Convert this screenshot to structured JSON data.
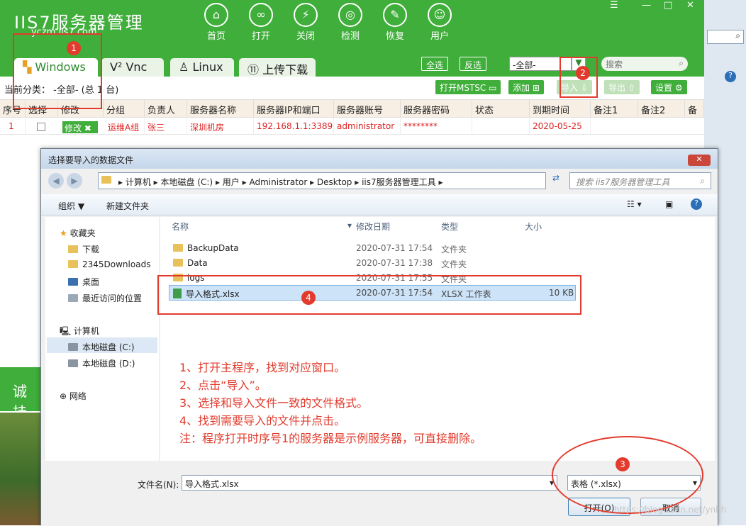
{
  "app": {
    "logo": "IIS7服务器管理",
    "logo_sub": "yczm.iis7.com",
    "toolbar": [
      {
        "label": "首页",
        "icon": "home-icon",
        "glyph": "⌂"
      },
      {
        "label": "打开",
        "icon": "link-icon",
        "glyph": "∞"
      },
      {
        "label": "关闭",
        "icon": "unlink-icon",
        "glyph": "⚡"
      },
      {
        "label": "检测",
        "icon": "detect-icon",
        "glyph": "◎"
      },
      {
        "label": "恢复",
        "icon": "wrench-icon",
        "glyph": "✎"
      },
      {
        "label": "用户",
        "icon": "user-icon",
        "glyph": "☺"
      }
    ],
    "tabs": [
      "Windows",
      "Vnc",
      "Linux",
      "上传下载"
    ],
    "select_all": "全选",
    "invert": "反选",
    "filter_value": "-全部-",
    "search_placeholder": "搜索",
    "category": "当前分类： -全部- (总 1 台)",
    "actions": [
      "打开MSTSC",
      "添加",
      "导入",
      "导出",
      "设置"
    ],
    "columns": [
      "序号",
      "选择",
      "修改",
      "分组",
      "负责人",
      "服务器名称",
      "服务器IP和端口",
      "服务器账号",
      "服务器密码",
      "状态",
      "到期时间",
      "备注1",
      "备注2",
      "备注"
    ],
    "row": {
      "index": "1",
      "edit": "修改",
      "group": "运维A组",
      "owner": "张三",
      "name": "深圳机房",
      "ip": "192.168.1.1:3389",
      "account": "administrator",
      "password": "********",
      "status": "",
      "expire": "2020-05-25"
    },
    "side_text": "诚 挂"
  },
  "dialog": {
    "title": "选择要导入的数据文件",
    "breadcrumb": [
      "计算机",
      "本地磁盘 (C:)",
      "用户",
      "Administrator",
      "Desktop",
      "iis7服务器管理工具"
    ],
    "search_placeholder": "搜索 iis7服务器管理工具",
    "organize": "组织 ▼",
    "new_folder": "新建文件夹",
    "nav": {
      "favorites": "收藏夹",
      "fav_items": [
        "下载",
        "2345Downloads",
        "桌面",
        "最近访问的位置"
      ],
      "computer": "计算机",
      "drives": [
        "本地磁盘 (C:)",
        "本地磁盘 (D:)"
      ],
      "network": "网络"
    },
    "col_headers": [
      "名称",
      "修改日期",
      "类型",
      "大小"
    ],
    "files": [
      {
        "name": "BackupData",
        "date": "2020-07-31 17:54",
        "type": "文件夹",
        "size": ""
      },
      {
        "name": "Data",
        "date": "2020-07-31 17:38",
        "type": "文件夹",
        "size": ""
      },
      {
        "name": "logs",
        "date": "2020-07-31 17:55",
        "type": "文件夹",
        "size": ""
      },
      {
        "name": "导入格式.xlsx",
        "date": "2020-07-31 17:54",
        "type": "XLSX 工作表",
        "size": "10 KB"
      }
    ],
    "notes": "1、打开主程序，找到对应窗口。\n2、点击“导入”。\n3、选择和导入文件一致的文件格式。\n4、找到需要导入的文件并点击。\n注：程序打开时序号1的服务器是示例服务器，可直接删除。",
    "filename_label": "文件名(N):",
    "filename": "导入格式.xlsx",
    "filetype": "表格 (*.xlsx)",
    "open_label": "打开(O)",
    "cancel_label": "取消"
  },
  "badges": [
    "1",
    "2",
    "3",
    "4"
  ],
  "watermark": "https://blog.csdn.net/ynhh"
}
